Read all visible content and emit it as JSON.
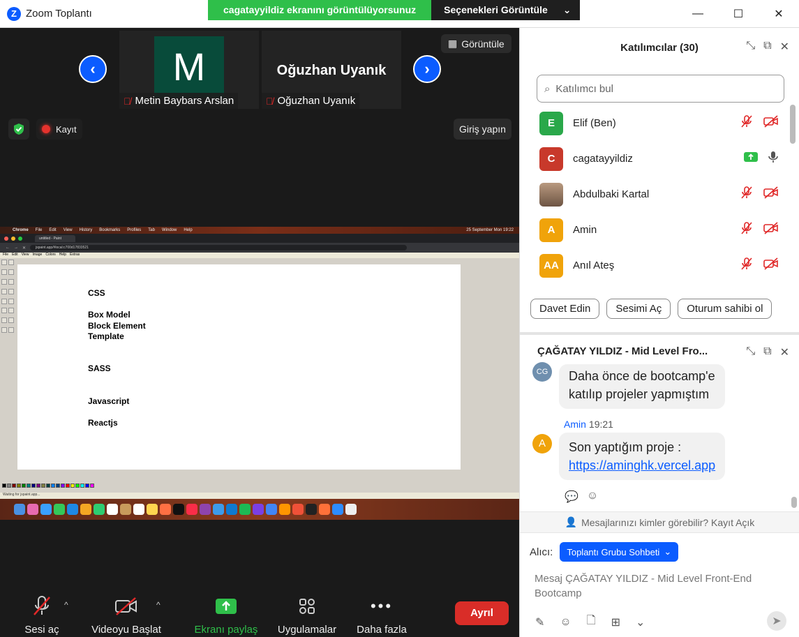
{
  "window": {
    "title": "Zoom Toplantı",
    "share_banner": "cagatayyildiz ekranını görüntülüyorsunuz",
    "share_options": "Seçenekleri Görüntüle"
  },
  "strip": {
    "tiles": [
      {
        "avatar_letter": "M",
        "name": "Metin Baybars Arslan"
      },
      {
        "big_name": "Oğuzhan Uyanık",
        "name": "Oğuzhan Uyanık"
      }
    ],
    "view_label": "Görüntüle",
    "record_label": "Kayıt",
    "login_label": "Giriş yapın"
  },
  "shared_screen": {
    "mac_menu": [
      "Chrome",
      "File",
      "Edit",
      "View",
      "History",
      "Bookmarks",
      "Profiles",
      "Tab",
      "Window",
      "Help"
    ],
    "clock": "25 September Mon 19:22",
    "tab_title": "untitled - Paint",
    "url": "jspaint.app/#local:c700d17833521",
    "paint_menu": [
      "File",
      "Edit",
      "View",
      "Image",
      "Colors",
      "Help",
      "Extras"
    ],
    "canvas_lines": [
      "CSS",
      "Box Model",
      "Block Element",
      "Template",
      "SASS",
      "Javascript",
      "Reactjs"
    ],
    "status_text": "Waiting for jspaint.app..."
  },
  "toolbar": {
    "mute_label": "Sesi aç",
    "video_label": "Videoyu Başlat",
    "share_label": "Ekranı paylaş",
    "apps_label": "Uygulamalar",
    "more_label": "Daha fazla",
    "leave_label": "Ayrıl"
  },
  "participants": {
    "title": "Katılımcılar (30)",
    "search_placeholder": "Katılımcı bul",
    "list": [
      {
        "initials": "E",
        "name": "Elif (Ben)",
        "color": "#2aa84a"
      },
      {
        "initials": "C",
        "name": "cagatayyildiz",
        "color": "#c8392b"
      },
      {
        "initials": "",
        "name": "Abdulbaki Kartal",
        "color": "#8a6d55"
      },
      {
        "initials": "A",
        "name": "Amin",
        "color": "#f0a30a"
      },
      {
        "initials": "AA",
        "name": "Anıl Ateş",
        "color": "#f0a30a"
      }
    ],
    "buttons": [
      "Davet Edin",
      "Sesimi Aç",
      "Oturum sahibi ol"
    ]
  },
  "chat": {
    "title": "ÇAĞATAY YILDIZ - Mid Level Fro...",
    "prev_avatar": "CG",
    "prev_message": [
      "Daha önce de bootcamp'e",
      "katılıp projeler yapmıştım"
    ],
    "sender": "Amin",
    "time": "19:21",
    "sender_avatar": "A",
    "message": "Son yaptığım proje :",
    "link": "https://aminghk.vercel.app",
    "visibility": "Mesajlarınızı kimler görebilir? Kayıt Açık",
    "to_label": "Alıcı:",
    "to_value": "Toplantı Grubu Sohbeti",
    "placeholder_line1": "Mesaj ÇAĞATAY YILDIZ - Mid Level Front-End",
    "placeholder_line2": "Bootcamp"
  },
  "colors": {
    "zoom_blue": "#0b5cff",
    "share_green": "#2fbf4a",
    "leave_red": "#d92d28"
  }
}
